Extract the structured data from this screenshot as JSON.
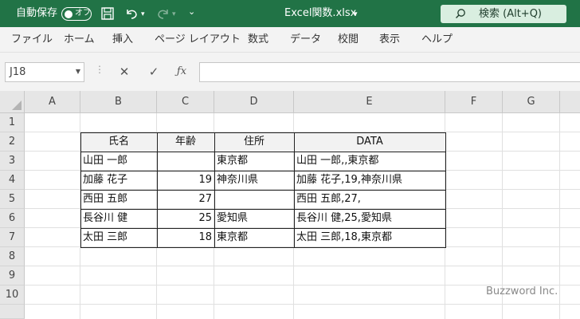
{
  "titlebar": {
    "autosave_label": "自動保存",
    "autosave_state": "オフ",
    "file_name": "Excel関数.xlsx",
    "search_label": "検索 (Alt+Q)",
    "accent": "#217346"
  },
  "menu": [
    "ファイル",
    "ホーム",
    "挿入",
    "ページ レイアウト",
    "数式",
    "データ",
    "校閲",
    "表示",
    "ヘルプ"
  ],
  "formula_bar": {
    "name_box": "J18",
    "formula": ""
  },
  "columns": [
    "A",
    "B",
    "C",
    "D",
    "E",
    "F",
    "G"
  ],
  "rows": [
    "1",
    "2",
    "3",
    "4",
    "5",
    "6",
    "7",
    "8",
    "9",
    "10"
  ],
  "table": {
    "headers": [
      "氏名",
      "年齢",
      "住所",
      "DATA"
    ],
    "rows": [
      [
        "山田 一郎",
        "",
        "東京都",
        "山田 一郎,,東京都"
      ],
      [
        "加藤 花子",
        "19",
        "神奈川県",
        "加藤 花子,19,神奈川県"
      ],
      [
        "西田 五郎",
        "27",
        "",
        "西田 五郎,27,"
      ],
      [
        "長谷川 健",
        "25",
        "愛知県",
        "長谷川 健,25,愛知県"
      ],
      [
        "太田 三郎",
        "18",
        "東京都",
        "太田 三郎,18,東京都"
      ]
    ]
  },
  "watermark": "Buzzword Inc."
}
